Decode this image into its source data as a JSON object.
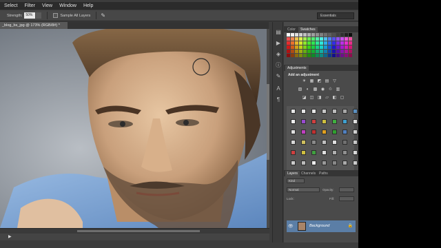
{
  "menubar": {
    "items": [
      "Select",
      "Filter",
      "View",
      "Window",
      "Help"
    ]
  },
  "options": {
    "strength_label": "Strength:",
    "strength_value": "50%",
    "sample_all_label": "Sample All Layers",
    "workspace": "Essentials"
  },
  "document": {
    "tab_title": "_blog_bs_jpg @ 173% (RGB/8#) *"
  },
  "color_panel": {
    "tabs": [
      "Color",
      "Swatches"
    ]
  },
  "adjustments_panel": {
    "tab": "Adjustments",
    "heading": "Add an adjustment"
  },
  "layers_panel": {
    "tabs": [
      "Layers",
      "Channels",
      "Paths"
    ],
    "kind_label": "Kind",
    "blend_mode": "Normal",
    "opacity_label": "Opacity:",
    "lock_label": "Lock:",
    "fill_label": "Fill:",
    "layer_name": "Background"
  },
  "colors": {
    "accent_selection": "#5b7ea6",
    "panel_bg": "#4a4a4a",
    "app_bg": "#3c3c3c"
  }
}
